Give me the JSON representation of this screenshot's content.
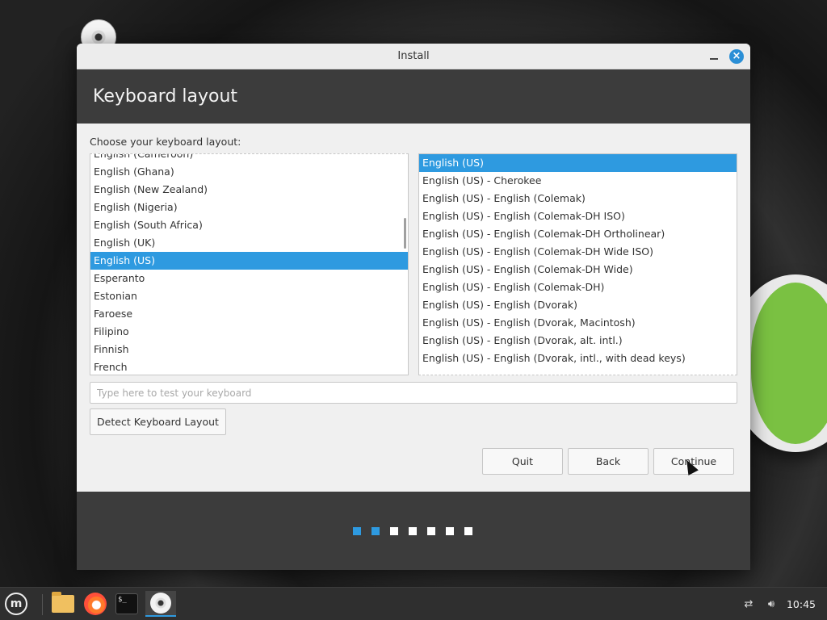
{
  "window": {
    "title": "Install"
  },
  "header": {
    "title": "Keyboard layout"
  },
  "main": {
    "prompt": "Choose your keyboard layout:",
    "layouts": [
      "English (Cameroon)",
      "English (Ghana)",
      "English (New Zealand)",
      "English (Nigeria)",
      "English (South Africa)",
      "English (UK)",
      "English (US)",
      "Esperanto",
      "Estonian",
      "Faroese",
      "Filipino",
      "Finnish",
      "French"
    ],
    "selected_layout": "English (US)",
    "variants": [
      "English (US)",
      "English (US) - Cherokee",
      "English (US) - English (Colemak)",
      "English (US) - English (Colemak-DH ISO)",
      "English (US) - English (Colemak-DH Ortholinear)",
      "English (US) - English (Colemak-DH Wide ISO)",
      "English (US) - English (Colemak-DH Wide)",
      "English (US) - English (Colemak-DH)",
      "English (US) - English (Dvorak)",
      "English (US) - English (Dvorak, Macintosh)",
      "English (US) - English (Dvorak, alt. intl.)",
      "English (US) - English (Dvorak, intl., with dead keys)"
    ],
    "selected_variant": "English (US)",
    "test_input": {
      "value": "",
      "placeholder": "Type here to test your keyboard"
    },
    "detect_button": "Detect Keyboard Layout",
    "quit_button": "Quit",
    "back_button": "Back",
    "continue_button": "Continue"
  },
  "progress": {
    "total_steps": 7,
    "active_steps": 2
  },
  "taskbar": {
    "clock": "10:45",
    "items": [
      "menu-icon",
      "files-icon",
      "firefox-icon",
      "terminal-icon",
      "installer-icon"
    ],
    "tray_icons": [
      "network-icon",
      "volume-icon"
    ]
  },
  "colors": {
    "accent": "#2e9ae0",
    "header_bg": "#3c3c3c",
    "window_bg": "#f0f0f0"
  }
}
